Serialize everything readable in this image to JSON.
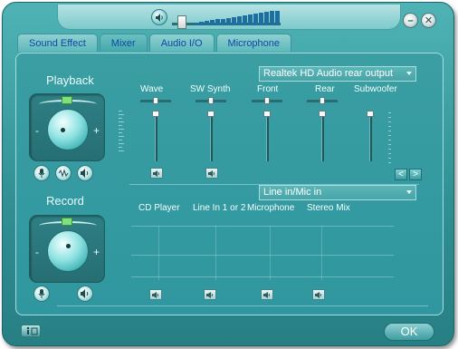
{
  "titlebar": {
    "volume_icon": "speaker-icon",
    "minimize_icon": "minimize-icon",
    "close_icon": "close-icon",
    "minimize_glyph": "–",
    "close_glyph": "✕"
  },
  "tabs": [
    {
      "label": "Sound Effect",
      "active": false
    },
    {
      "label": "Mixer",
      "active": true
    },
    {
      "label": "Audio I/O",
      "active": false
    },
    {
      "label": "Microphone",
      "active": false
    }
  ],
  "playback": {
    "title": "Playback",
    "knob_minus": "-",
    "knob_plus": "+",
    "device": "Realtek HD Audio rear output",
    "channels": [
      {
        "label": "Wave"
      },
      {
        "label": "SW Synth"
      },
      {
        "label": "Front"
      },
      {
        "label": "Rear"
      },
      {
        "label": "Subwoofer"
      }
    ],
    "icons": [
      "microphone-icon",
      "waveform-icon",
      "speaker-icon"
    ],
    "nav_prev": "<",
    "nav_next": ">"
  },
  "record": {
    "title": "Record",
    "knob_minus": "-",
    "knob_plus": "+",
    "source": "Line in/Mic in",
    "channels": [
      {
        "label": "CD Player"
      },
      {
        "label": "Line In 1 or 2"
      },
      {
        "label": "Microphone"
      },
      {
        "label": "Stereo Mix"
      }
    ],
    "icons": [
      "microphone-icon",
      "speaker-icon"
    ]
  },
  "footer": {
    "ok_label": "OK",
    "info_icon": "info-icon"
  }
}
